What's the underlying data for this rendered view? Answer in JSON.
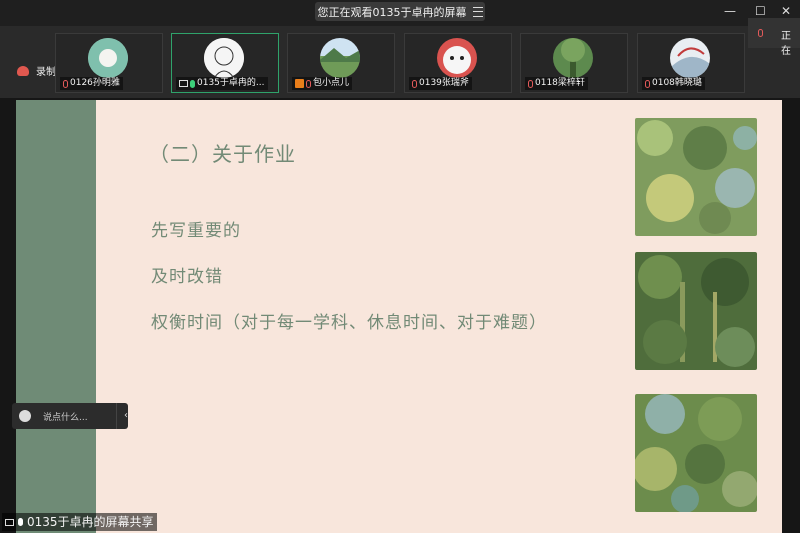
{
  "banner": {
    "text": "您正在观看0135于卓冉的屏幕"
  },
  "window": {
    "min": "—",
    "max": "☐",
    "close": "✕",
    "side_text": "正在"
  },
  "recording": {
    "label": "录制中"
  },
  "participants": [
    {
      "name": "0126孙明雅"
    },
    {
      "name": "0135于卓冉的..."
    },
    {
      "name": "包小点儿"
    },
    {
      "name": "0139张瑞斧"
    },
    {
      "name": "0118梁梓轩"
    },
    {
      "name": "0108韩晓璐"
    }
  ],
  "slide": {
    "title": "（二）关于作业",
    "items": [
      "先写重要的",
      "及时改错",
      "权衡时间（对于每一学科、休息时间、对于难题）"
    ]
  },
  "chat": {
    "placeholder": "说点什么..."
  },
  "share": {
    "label": "0135于卓冉的屏幕共享"
  },
  "colors": {
    "slide_bg": "#f8e6dc",
    "sidebar_green": "#6f8b76",
    "text_green": "#728a76",
    "active_border": "#2fa36b"
  }
}
